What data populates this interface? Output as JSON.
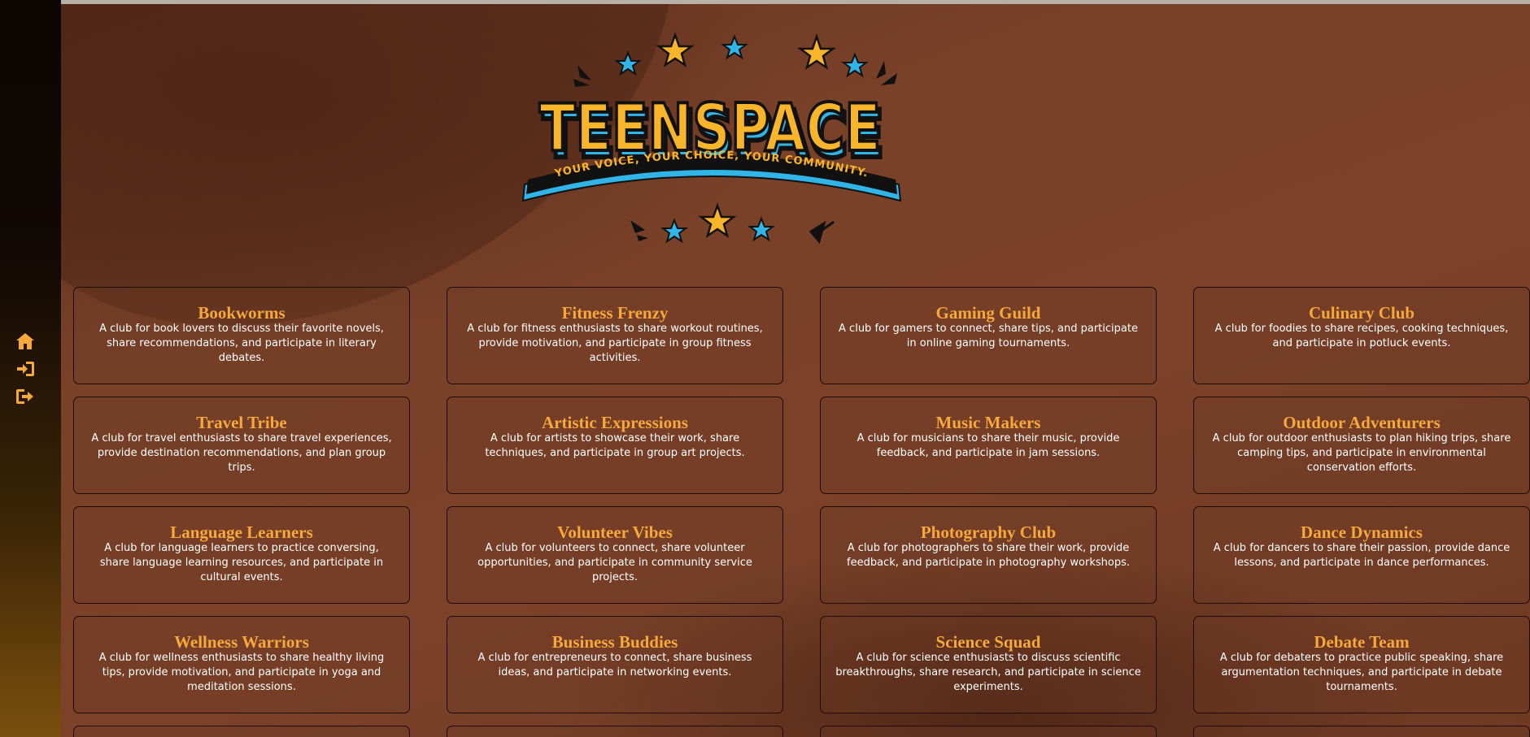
{
  "app": {
    "logo_title": "TEENSPACE",
    "logo_tagline": "YOUR VOICE, YOUR CHOICE, YOUR COMMUNITY."
  },
  "sidebar": {
    "items": [
      {
        "icon": "home-icon"
      },
      {
        "icon": "sign-in-icon"
      },
      {
        "icon": "sign-out-icon"
      }
    ]
  },
  "colors": {
    "accent": "#f6a93a",
    "card_border": "#1d0d06",
    "background": "#6e3a24"
  },
  "clubs": [
    {
      "title": "Bookworms",
      "description": "A club for book lovers to discuss their favorite novels, share recommendations, and participate in literary debates."
    },
    {
      "title": "Fitness Frenzy",
      "description": "A club for fitness enthusiasts to share workout routines, provide motivation, and participate in group fitness activities."
    },
    {
      "title": "Gaming Guild",
      "description": "A club for gamers to connect, share tips, and participate in online gaming tournaments."
    },
    {
      "title": "Culinary Club",
      "description": "A club for foodies to share recipes, cooking techniques, and participate in potluck events."
    },
    {
      "title": "Travel Tribe",
      "description": "A club for travel enthusiasts to share travel experiences, provide destination recommendations, and plan group trips."
    },
    {
      "title": "Artistic Expressions",
      "description": "A club for artists to showcase their work, share techniques, and participate in group art projects."
    },
    {
      "title": "Music Makers",
      "description": "A club for musicians to share their music, provide feedback, and participate in jam sessions."
    },
    {
      "title": "Outdoor Adventurers",
      "description": "A club for outdoor enthusiasts to plan hiking trips, share camping tips, and participate in environmental conservation efforts."
    },
    {
      "title": "Language Learners",
      "description": "A club for language learners to practice conversing, share language learning resources, and participate in cultural events."
    },
    {
      "title": "Volunteer Vibes",
      "description": "A club for volunteers to connect, share volunteer opportunities, and participate in community service projects."
    },
    {
      "title": "Photography Club",
      "description": "A club for photographers to share their work, provide feedback, and participate in photography workshops."
    },
    {
      "title": "Dance Dynamics",
      "description": "A club for dancers to share their passion, provide dance lessons, and participate in dance performances."
    },
    {
      "title": "Wellness Warriors",
      "description": "A club for wellness enthusiasts to share healthy living tips, provide motivation, and participate in yoga and meditation sessions."
    },
    {
      "title": "Business Buddies",
      "description": "A club for entrepreneurs to connect, share business ideas, and participate in networking events."
    },
    {
      "title": "Science Squad",
      "description": "A club for science enthusiasts to discuss scientific breakthroughs, share research, and participate in science experiments."
    },
    {
      "title": "Debate Team",
      "description": "A club for debaters to practice public speaking, share argumentation techniques, and participate in debate tournaments."
    }
  ]
}
